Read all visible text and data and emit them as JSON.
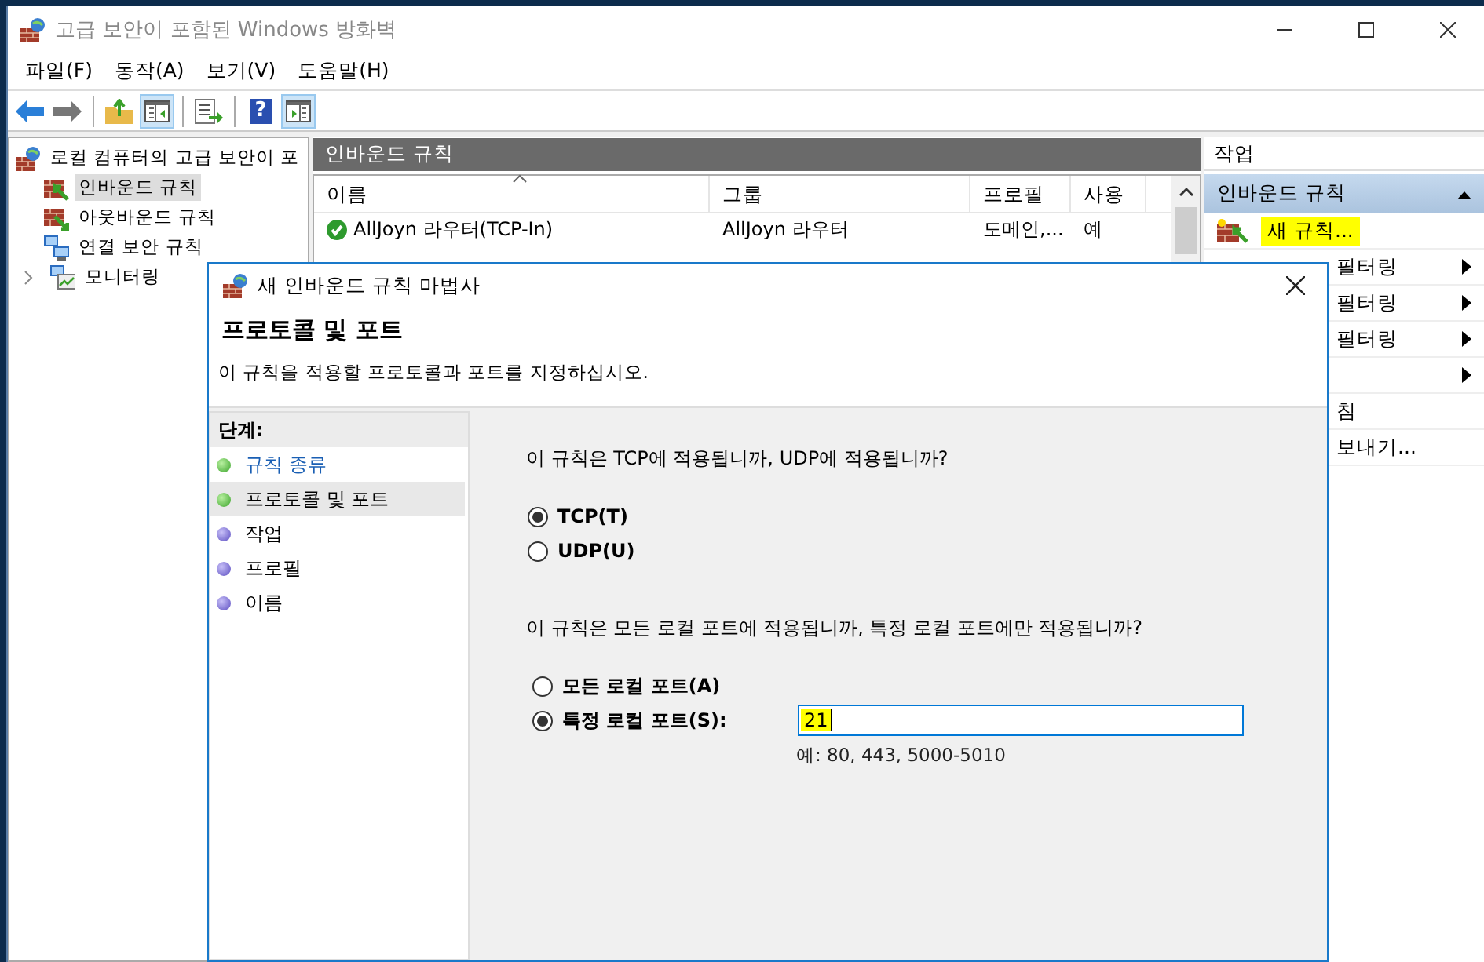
{
  "window": {
    "title": "고급 보안이 포함된 Windows 방화벽"
  },
  "menu": [
    {
      "label": "파일(F)"
    },
    {
      "label": "동작(A)"
    },
    {
      "label": "보기(V)"
    },
    {
      "label": "도움말(H)"
    }
  ],
  "toolbar": [
    {
      "kind": "back",
      "pressed": false
    },
    {
      "kind": "forward",
      "pressed": false
    },
    {
      "kind": "separator"
    },
    {
      "kind": "up-folder",
      "pressed": false
    },
    {
      "kind": "console-tree",
      "pressed": true
    },
    {
      "kind": "separator"
    },
    {
      "kind": "export",
      "pressed": false
    },
    {
      "kind": "separator"
    },
    {
      "kind": "help",
      "glyph": "?",
      "pressed": false
    },
    {
      "kind": "action-pane",
      "pressed": true
    }
  ],
  "tree": {
    "label": "로컬 컴퓨터의 고급 보안이 포",
    "children": [
      {
        "label": "인바운드 규칙",
        "kind": "inbound",
        "selected": true,
        "highlighted": true
      },
      {
        "label": "아웃바운드 규칙",
        "kind": "outbound",
        "selected": false,
        "highlighted": false
      },
      {
        "label": "연결 보안 규칙",
        "kind": "connection",
        "selected": false,
        "highlighted": false
      },
      {
        "label": "모니터링",
        "kind": "monitor",
        "selected": false,
        "highlighted": false,
        "expanded": false
      }
    ]
  },
  "rules_pane": {
    "title": "인바운드 규칙",
    "columns": [
      {
        "label": "이름",
        "sorted": true
      },
      {
        "label": "그룹",
        "sorted": false
      },
      {
        "label": "프로필",
        "sorted": false
      },
      {
        "label": "사용",
        "sorted": false
      }
    ],
    "rows": [
      {
        "enabled": true,
        "cells": [
          "AllJoyn 라우터(TCP-In)",
          "AllJoyn 라우터",
          "도메인,...",
          "예"
        ]
      }
    ]
  },
  "actions_pane": {
    "title": "작업",
    "section": {
      "label": "인바운드 규칙",
      "expanded": true
    },
    "items": [
      {
        "label": "새 규칙...",
        "kind": "new-rule",
        "highlighted": true,
        "submenu": false
      },
      {
        "label": "필터링",
        "kind": "plain",
        "highlighted": false,
        "submenu": true
      },
      {
        "label": "필터링",
        "kind": "plain",
        "highlighted": false,
        "submenu": true
      },
      {
        "label": "필터링",
        "kind": "plain",
        "highlighted": false,
        "submenu": true
      },
      {
        "kind": "plain",
        "submenu": true
      },
      {
        "label": "침",
        "kind": "plain",
        "highlighted": false,
        "submenu": false
      },
      {
        "label": "보내기...",
        "kind": "plain",
        "highlighted": false,
        "submenu": false
      }
    ]
  },
  "wizard": {
    "title": "새 인바운드 규칙 마법사",
    "heading": "프로토콜 및 포트",
    "description": "이 규칙을 적용할 프로토콜과 포트를 지정하십시오.",
    "steps_title": "단계:",
    "steps": [
      {
        "label": "규칙 종류",
        "done": true,
        "selected": false
      },
      {
        "label": "프로토콜 및 포트",
        "done": true,
        "selected": true
      },
      {
        "label": "작업",
        "done": false,
        "selected": false
      },
      {
        "label": "프로필",
        "done": false,
        "selected": false
      },
      {
        "label": "이름",
        "done": false,
        "selected": false
      }
    ],
    "questions": [
      {
        "prompt": "이 규칙은 TCP에 적용됩니까, UDP에 적용됩니까?",
        "options": [
          {
            "label": "TCP(T)",
            "selected": true
          },
          {
            "label": "UDP(U)",
            "selected": false
          }
        ]
      },
      {
        "prompt": "이 규칙은 모든 로컬 포트에 적용됩니까, 특정 로컬 포트에만 적용됩니까?",
        "options": [
          {
            "label": "모든 로컬 포트(A)",
            "selected": false
          },
          {
            "label": "특정 로컬 포트(S):",
            "selected": true,
            "field": {
              "value": "21",
              "highlighted": true,
              "hint": "예: 80, 443, 5000-5010"
            }
          }
        ]
      }
    ]
  }
}
